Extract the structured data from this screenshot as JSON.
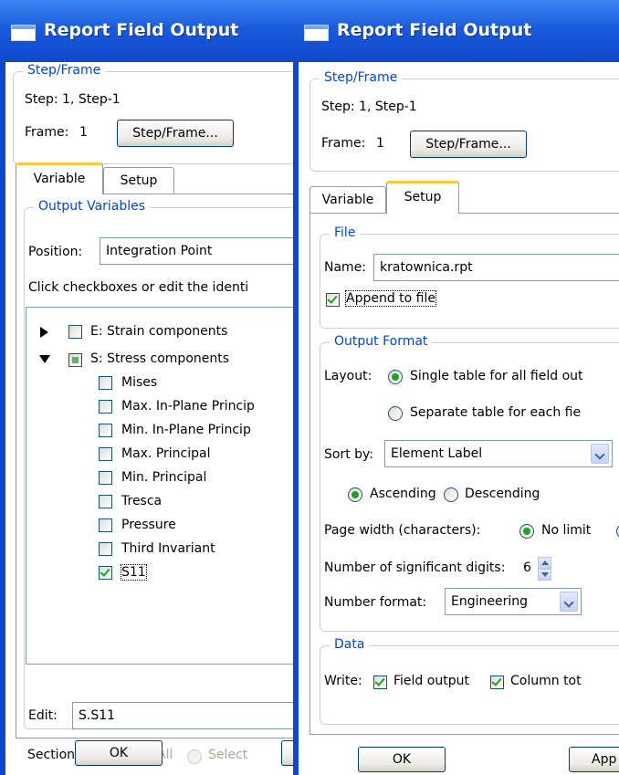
{
  "left": {
    "title": "Report Field Output",
    "step_frame": {
      "group_label": "Step/Frame",
      "step_text": "Step: 1, Step-1",
      "frame_label": "Frame:",
      "frame_value": "1",
      "button_label": "Step/Frame..."
    },
    "tabs": [
      "Variable",
      "Setup"
    ],
    "output_variables": {
      "group_label": "Output Variables",
      "position_label": "Position:",
      "position_value": "Integration Point",
      "instruction": "Click checkboxes or edit the identi",
      "tree": {
        "e_label": "E: Strain components",
        "s_label": "S: Stress components",
        "children": [
          "Mises",
          "Max. In-Plane Princip",
          "Min. In-Plane Princip",
          "Max. Principal",
          "Min. Principal",
          "Tresca",
          "Pressure",
          "Third Invariant",
          "S11"
        ]
      },
      "edit_label": "Edit:",
      "edit_value": "S.S11",
      "section_point_label": "Section point:",
      "section_all": "All",
      "section_select": "Select"
    },
    "ok_label": "OK"
  },
  "right": {
    "title": "Report Field Output",
    "step_frame": {
      "group_label": "Step/Frame",
      "step_text": "Step: 1, Step-1",
      "frame_label": "Frame:",
      "frame_value": "1",
      "button_label": "Step/Frame..."
    },
    "tabs": [
      "Variable",
      "Setup"
    ],
    "file": {
      "group_label": "File",
      "name_label": "Name:",
      "name_value": "kratownica.rpt",
      "append_label": "Append to file"
    },
    "output_format": {
      "group_label": "Output Format",
      "layout_label": "Layout:",
      "layout_option1": "Single table for all field out",
      "layout_option2": "Separate table for each fie",
      "sort_label": "Sort by:",
      "sort_value": "Element Label",
      "ascending": "Ascending",
      "descending": "Descending",
      "page_width_label": "Page width (characters):",
      "no_limit": "No limit",
      "sig_digits_label": "Number of significant digits:",
      "sig_digits_value": "6",
      "number_format_label": "Number format:",
      "number_format_value": "Engineering"
    },
    "data": {
      "group_label": "Data",
      "write_label": "Write:",
      "field_output": "Field output",
      "column_totals": "Column tot"
    },
    "ok_label": "OK",
    "apply_label": "App"
  }
}
